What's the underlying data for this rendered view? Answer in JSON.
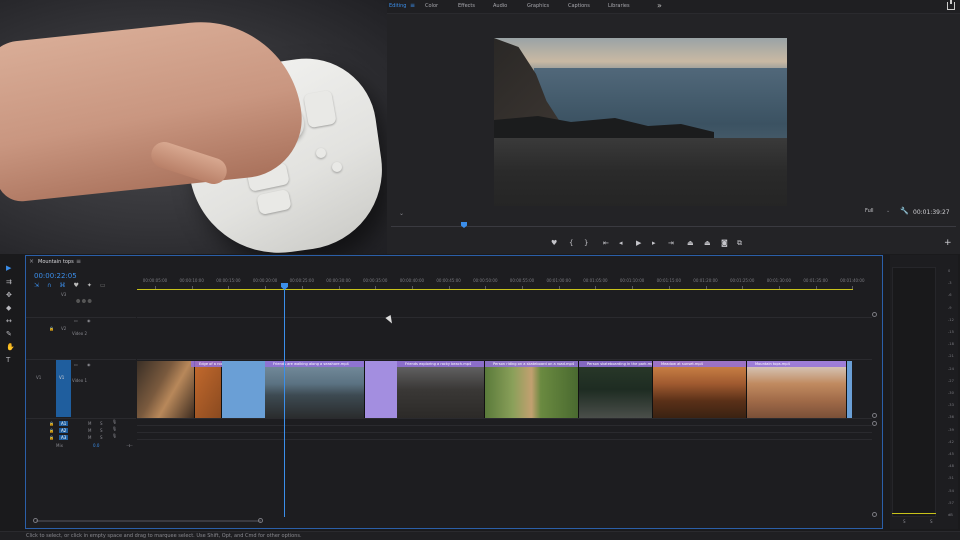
{
  "workspaces": [
    "Editing",
    "Color",
    "Effects",
    "Audio",
    "Graphics",
    "Captions",
    "Libraries"
  ],
  "active_workspace": "Editing",
  "program": {
    "zoom_label": "Full",
    "timecode": "00:01:39:27"
  },
  "timeline": {
    "sequence_name": "Mountain tops",
    "timecode": "00:00:22:05",
    "ruler": [
      "00:00:05:00",
      "00:00:10:00",
      "00:00:15:00",
      "00:00:20:00",
      "00:00:25:00",
      "00:00:30:00",
      "00:00:35:00",
      "00:00:40:00",
      "00:00:45:00",
      "00:00:50:00",
      "00:00:55:00",
      "00:01:00:00",
      "00:01:05:00",
      "00:01:10:00",
      "00:01:15:00",
      "00:01:20:00",
      "00:01:25:00",
      "00:01:30:00",
      "00:01:35:00",
      "00:01:40:00"
    ],
    "tracks": {
      "v3": "V3",
      "v2": "V2",
      "v2_name": "Video 2",
      "v1": "V1",
      "v1_name": "Video 1",
      "a1": "A1",
      "a2": "A2",
      "a3": "A3",
      "mix": "Mix",
      "mix_value": "0.0"
    },
    "clips": [
      {
        "label": "Edge of a rocky mountain.mp4"
      },
      {
        "label": "Friends are walking along a seashore.mp4"
      },
      {
        "label": "Friends exploring a rocky beach.mp4"
      },
      {
        "label": "Person riding on a skateboard on a road.mp4"
      },
      {
        "label": "Person skateboarding in the park.mp4"
      },
      {
        "label": "Meadow at sunset.mp4"
      },
      {
        "label": "Mountain tops.mp4"
      }
    ]
  },
  "meters": {
    "scale": [
      "0",
      "-3",
      "-6",
      "-9",
      "-12",
      "-15",
      "-18",
      "-21",
      "-24",
      "-27",
      "-30",
      "-33",
      "-36",
      "-39",
      "-42",
      "-45",
      "-48",
      "-51",
      "-54",
      "-57",
      "dB"
    ],
    "solo_left": "S",
    "solo_right": "S"
  },
  "status_bar": "Click to select, or click in empty space and drag to marquee select. Use Shift, Opt, and Cmd for other options.",
  "colors": {
    "accent": "#3b8eea",
    "clip_label": "#9370dc",
    "workarea": "#c8c21a"
  }
}
